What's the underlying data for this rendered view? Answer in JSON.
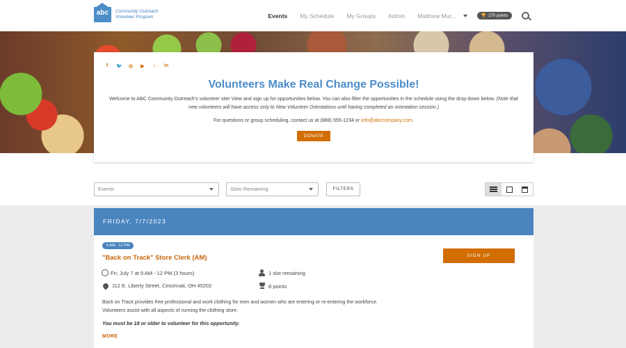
{
  "header": {
    "logo_mark": "abc",
    "logo_line1": "Community Outreach",
    "logo_line2": "Volunteer Program",
    "nav": [
      "Events",
      "My Schedule",
      "My Groups",
      "Admin"
    ],
    "user_name": "Matthew Mur...",
    "points": "270 points",
    "icons": {
      "search": "search-icon",
      "trophy": "trophy-icon",
      "caret": "chevron-down-icon"
    }
  },
  "hero": {
    "social": [
      "f",
      "t",
      "ig",
      "yt",
      "tk",
      "in"
    ],
    "title": "Volunteers Make Real Change Possible!",
    "intro": "Welcome to ABC Community Outreach's volunteer site! View and sign up for opportunities below. You can also filter the opportunities in the schedule using the drop-down below.",
    "note": "(Note that new volunteers will have access only to New Volunteer Orientations until having completed an orientation session.)",
    "contact_prefix": "For questions or group scheduling, contact us at (888) 555-1234 or ",
    "contact_email": "info@abccompany.com",
    "contact_suffix": ".",
    "donate_label": "DONATE"
  },
  "filters": {
    "events_placeholder": "Events",
    "slots_placeholder": "Slots Remaining",
    "filters_label": "FILTERS",
    "views": [
      "list-view-icon",
      "map-view-icon",
      "calendar-view-icon"
    ],
    "active_view": "list"
  },
  "schedule": {
    "day_label": "FRIDAY, 7/7/2023",
    "events": [
      {
        "time_pill": "9 AM - 12 PM",
        "title": "\"Back on Track\" Store Clerk (AM)",
        "datetime": "Fri, July 7 at 9 AM - 12 PM (3 hours)",
        "address": "112 E. Liberty Street, Cincinnati, OH 45202",
        "slots": "1 slot remaining",
        "points": "8 points",
        "description": "Back on Track provides free professional and work clothing for men and women who are entering or re-entering the workforce. Volunteers assist with all aspects of running the clothing store.",
        "age_note": "You must be 18 or older to volunteer for this opportunity.",
        "more_label": "MORE",
        "signup_label": "SIGN UP"
      }
    ]
  },
  "colors": {
    "accent_orange": "#d26d00",
    "accent_blue": "#4a85c0",
    "title_blue": "#4d8cc8"
  }
}
